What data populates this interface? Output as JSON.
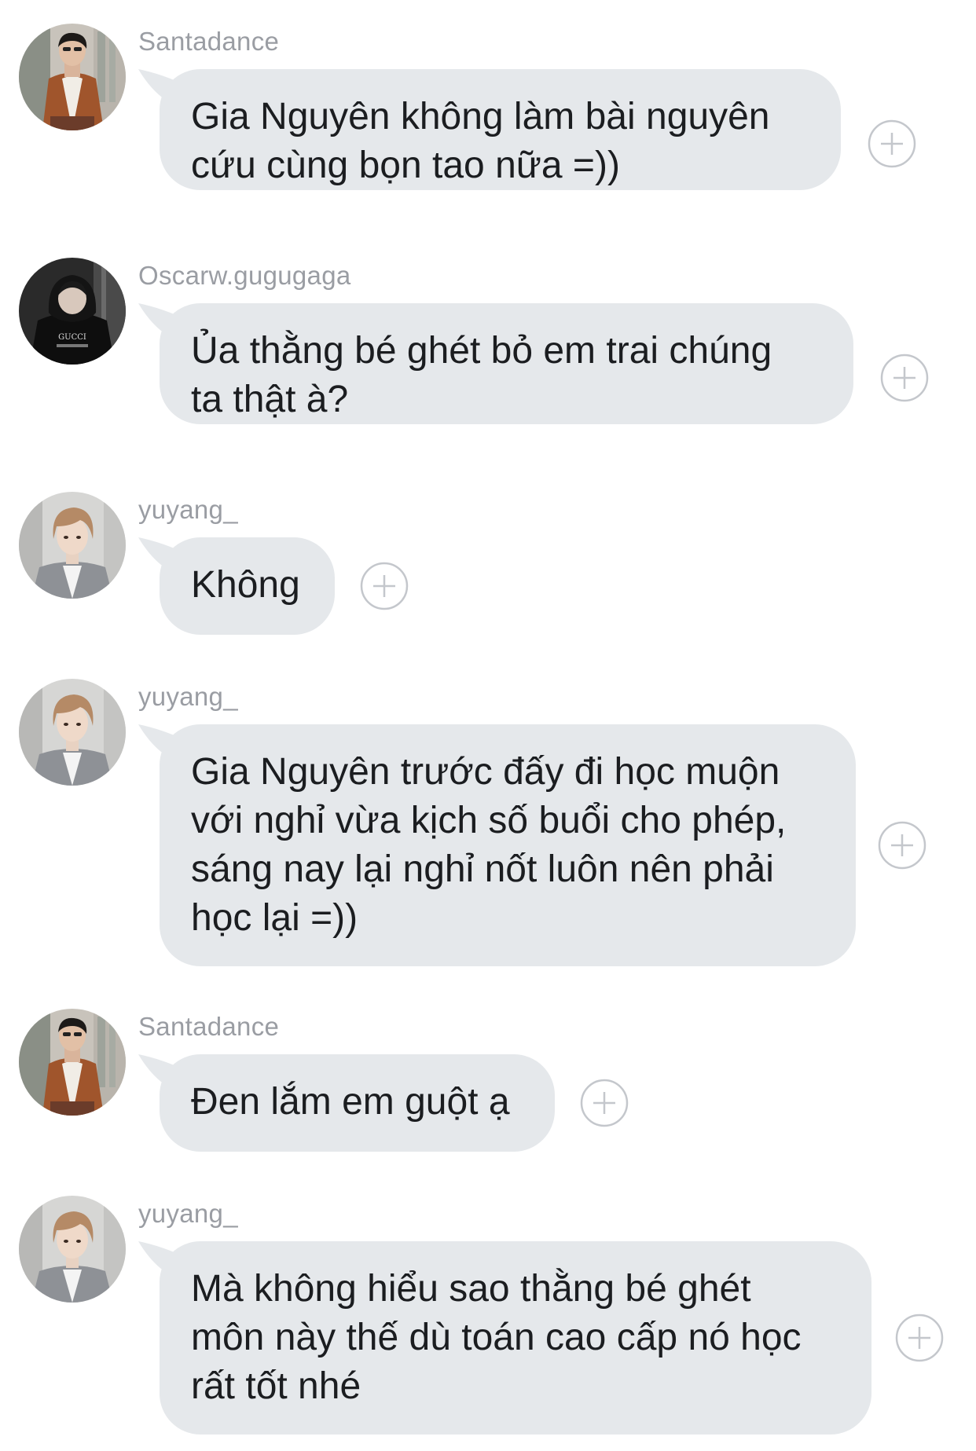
{
  "messages": [
    {
      "sender": "Santadance",
      "avatar_icon": "santadance-avatar",
      "text_lines": [
        "Gia Nguyên không làm bài nguyên",
        "cứu cùng bọn tao nữa =))"
      ]
    },
    {
      "sender": "Oscarw.gugugaga",
      "avatar_icon": "oscarw-avatar",
      "text_lines": [
        "Ủa thằng bé ghét bỏ em trai chúng",
        "ta thật à?"
      ]
    },
    {
      "sender": "yuyang_",
      "avatar_icon": "yuyang-avatar",
      "text_lines": [
        "Không"
      ]
    },
    {
      "sender": "yuyang_",
      "avatar_icon": "yuyang-avatar",
      "text_lines": [
        "Gia Nguyên trước đấy đi học muộn",
        "với nghỉ vừa kịch số buổi cho phép,",
        "sáng nay lại nghỉ nốt luôn nên phải",
        "học lại =))"
      ]
    },
    {
      "sender": "Santadance",
      "avatar_icon": "santadance-avatar",
      "text_lines": [
        "Đen lắm em guột ạ"
      ]
    },
    {
      "sender": "yuyang_",
      "avatar_icon": "yuyang-avatar",
      "text_lines": [
        "Mà không hiểu sao thằng bé ghét",
        "môn này thế dù toán cao cấp nó học",
        "rất tốt nhé"
      ]
    }
  ],
  "react_icon": "add-reaction-icon",
  "colors": {
    "bubble": "#e5e8eb",
    "sender_text": "#9a9da3",
    "message_text": "#1b1d20",
    "plus_icon": "#c4c7cc"
  }
}
